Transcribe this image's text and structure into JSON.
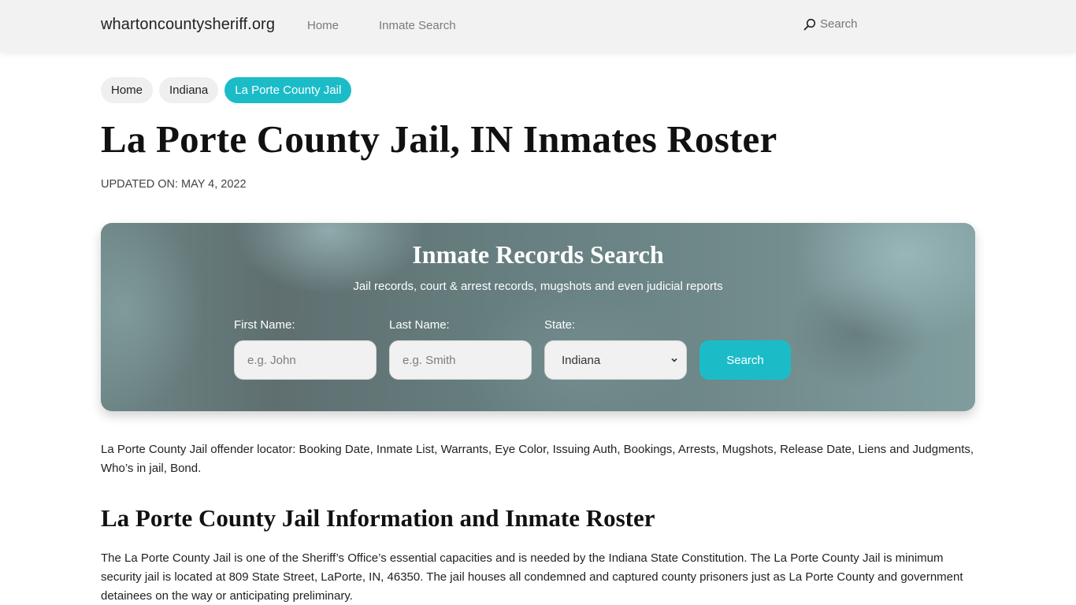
{
  "navbar": {
    "brand": "whartoncountysheriff.org",
    "links": [
      {
        "label": "Home"
      },
      {
        "label": "Inmate Search"
      }
    ],
    "search": {
      "icon": "search-icon",
      "label": "Search"
    }
  },
  "breadcrumb": [
    {
      "label": "Home",
      "active": false
    },
    {
      "label": "Indiana",
      "active": false
    },
    {
      "label": "La Porte County Jail",
      "active": true
    }
  ],
  "page": {
    "title": "La Porte County Jail, IN Inmates Roster",
    "updated": "UPDATED ON: MAY 4, 2022"
  },
  "search_banner": {
    "title": "Inmate Records Search",
    "subtitle": "Jail records, court & arrest records, mugshots and even judicial reports",
    "first_name": {
      "label": "First Name:",
      "placeholder": "e.g. John",
      "value": ""
    },
    "last_name": {
      "label": "Last Name:",
      "placeholder": "e.g. Smith",
      "value": ""
    },
    "state": {
      "label": "State:",
      "selected": "Indiana"
    },
    "button_label": "Search"
  },
  "content": {
    "intro": "La Porte County Jail offender locator: Booking Date, Inmate List, Warrants, Eye Color, Issuing Auth, Bookings, Arrests, Mugshots, Release Date, Liens and Judgments, Who’s in jail, Bond.",
    "section_title": "La Porte County Jail Information and Inmate Roster",
    "section_paragraph": "The La Porte County Jail is one of the Sheriff’s Office’s essential capacities and is needed by the Indiana State Constitution. The La Porte County Jail is minimum security jail is located at 809 State Street, LaPorte, IN, 46350. The jail houses all condemned and captured county prisoners just as La Porte County and government detainees on the way or anticipating preliminary."
  },
  "colors": {
    "accent": "#1bbcc8",
    "navbar_bg": "#f2f2f2",
    "pill_bg": "#efefef"
  }
}
